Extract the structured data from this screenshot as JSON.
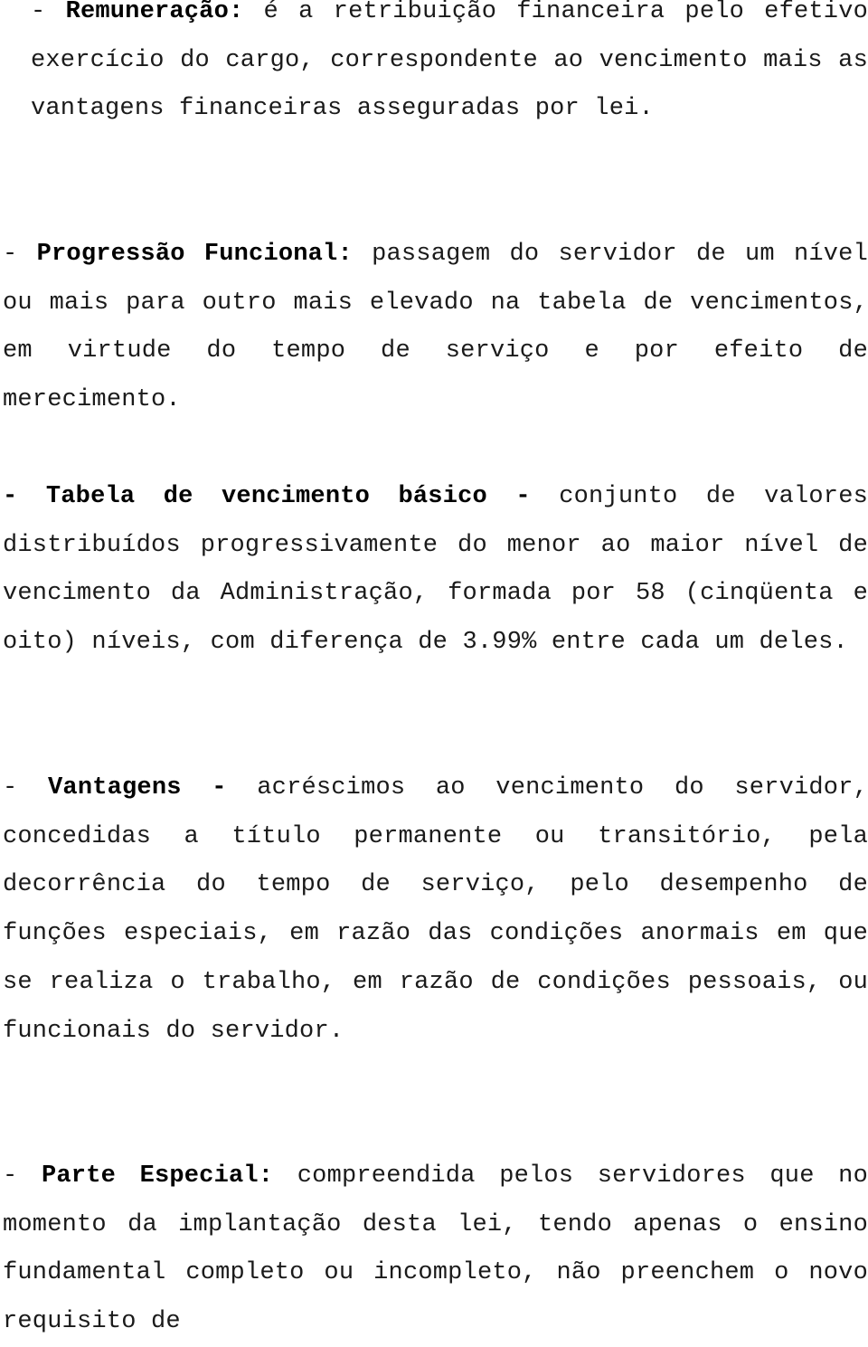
{
  "document": {
    "paragraphs": [
      {
        "dash": "- ",
        "term": "Remuneração:",
        "text": " é a retribuição financeira pelo efetivo exercício do cargo, correspondente ao vencimento mais as vantagens financeiras asseguradas por lei."
      },
      {
        "dash": "- ",
        "term": "Progressão Funcional:",
        "text": " passagem do servidor de um nível ou mais para outro mais elevado na tabela de vencimentos, em virtude do tempo de serviço e por efeito de merecimento."
      },
      {
        "dash": "- ",
        "term": "Tabela de vencimento básico -",
        "text": " conjunto de valores distribuídos progressivamente do menor ao maior nível de vencimento da Administração, formada por 58 (cinqüenta e oito) níveis, com diferença de 3.99% entre cada um deles."
      },
      {
        "dash": "- ",
        "term": "Vantagens -",
        "text": " acréscimos ao vencimento do servidor, concedidas a título permanente ou transitório, pela decorrência do tempo de serviço, pelo desempenho de funções especiais, em razão das condições anormais em que se realiza o trabalho, em razão de condições pessoais, ou funcionais do servidor."
      },
      {
        "dash": "- ",
        "term": "Parte Especial:",
        "text": " compreendida pelos servidores que no momento da implantação desta lei, tendo apenas o ensino fundamental completo ou incompleto, não preenchem o novo requisito de"
      }
    ]
  }
}
